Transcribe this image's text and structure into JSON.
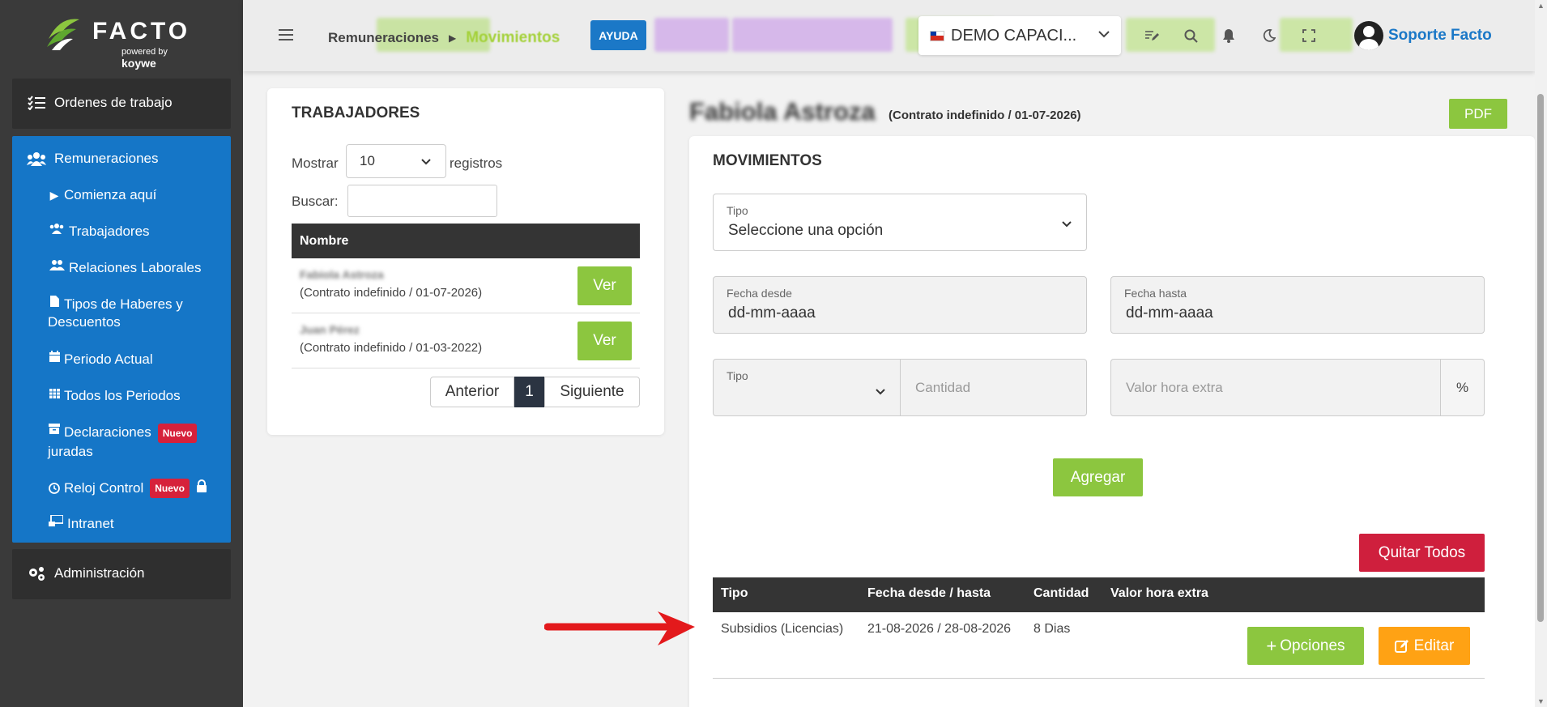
{
  "logo": {
    "wordmark": "FACTO",
    "powered_by": "powered by",
    "brand": "koywe"
  },
  "sidebar": {
    "top_item": "Ordenes de trabajo",
    "section": "Remuneraciones",
    "items": [
      {
        "label": "Comienza aquí",
        "icon": "play-icon"
      },
      {
        "label": "Trabajadores",
        "icon": "users-icon"
      },
      {
        "label": "Relaciones Laborales",
        "icon": "user-group-icon"
      },
      {
        "label": "Tipos de Haberes y",
        "label2": "Descuentos",
        "icon": "document-icon"
      },
      {
        "label": "Periodo Actual",
        "icon": "calendar-icon"
      },
      {
        "label": "Todos los Periodos",
        "icon": "calendar-grid-icon"
      },
      {
        "label": "Declaraciones",
        "label2": "juradas",
        "badge": "Nuevo",
        "icon": "archive-icon"
      },
      {
        "label": "Reloj Control",
        "badge": "Nuevo",
        "icon": "clock-icon"
      },
      {
        "label": "Intranet",
        "icon": "monitor-icon"
      }
    ],
    "admin": "Administración"
  },
  "topbar": {
    "breadcrumb_parent": "Remuneraciones",
    "breadcrumb_current": "Movimientos",
    "help": "AYUDA",
    "company": "DEMO CAPACI...",
    "user": "Soporte Facto"
  },
  "workers": {
    "title": "TRABAJADORES",
    "show_label": "Mostrar",
    "show_value": "10",
    "records_label": "registros",
    "search_label": "Buscar:",
    "search_value": "",
    "column": "Nombre",
    "rows": [
      {
        "name": "Fabiola Astroza",
        "contract": "(Contrato indefinido / 01-07-2026)",
        "action": "Ver"
      },
      {
        "name": "Juan Pérez",
        "contract": "(Contrato indefinido / 01-03-2022)",
        "action": "Ver"
      }
    ],
    "prev": "Anterior",
    "page": "1",
    "next": "Siguiente"
  },
  "employee": {
    "name": "Fabiola Astroza",
    "contract": "(Contrato indefinido / 01-07-2026)",
    "pdf": "PDF"
  },
  "movements": {
    "title": "MOVIMIENTOS",
    "type_label": "Tipo",
    "type_value": "Seleccione una opción",
    "date_from_label": "Fecha desde",
    "date_from_value": "dd-mm-aaaa",
    "date_to_label": "Fecha hasta",
    "date_to_value": "dd-mm-aaaa",
    "type2_label": "Tipo",
    "quantity_placeholder": "Cantidad",
    "overtime_placeholder": "Valor hora extra",
    "percent": "%",
    "add": "Agregar",
    "remove_all": "Quitar Todos",
    "columns": [
      "Tipo",
      "Fecha desde / hasta",
      "Cantidad",
      "Valor hora extra"
    ],
    "rows": [
      {
        "tipo": "Subsidios (Licencias)",
        "fechas": "21-08-2026 / 28-08-2026",
        "cantidad": "8 Dias",
        "valor": "",
        "options": "Opciones",
        "edit": "Editar"
      }
    ]
  },
  "colors": {
    "brand_green": "#8cc63f",
    "sidebar_blue": "#1576c7",
    "danger": "#cf1f3d",
    "warning": "#ffa214",
    "arrow": "#e3191c"
  }
}
